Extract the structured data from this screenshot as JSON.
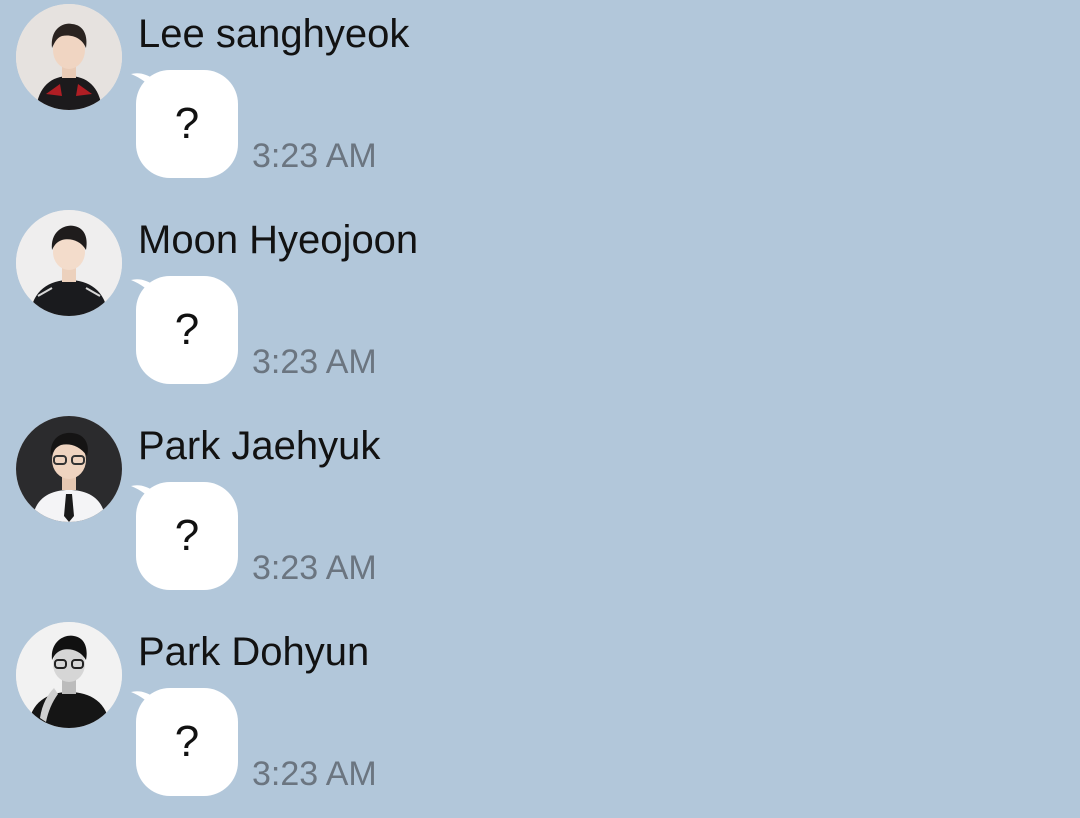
{
  "messages": [
    {
      "sender": "Lee sanghyeok",
      "text": "?",
      "time": "3:23 AM",
      "avatar_icon": "profile-photo-icon"
    },
    {
      "sender": "Moon Hyeojoon",
      "text": "?",
      "time": "3:23 AM",
      "avatar_icon": "profile-photo-icon"
    },
    {
      "sender": "Park Jaehyuk",
      "text": "?",
      "time": "3:23 AM",
      "avatar_icon": "profile-photo-icon"
    },
    {
      "sender": "Park Dohyun",
      "text": "?",
      "time": "3:23 AM",
      "avatar_icon": "profile-photo-icon"
    }
  ],
  "colors": {
    "background": "#b2c7da",
    "bubble": "#ffffff",
    "timestamp": "#6b7580",
    "sender_text": "#121212"
  }
}
